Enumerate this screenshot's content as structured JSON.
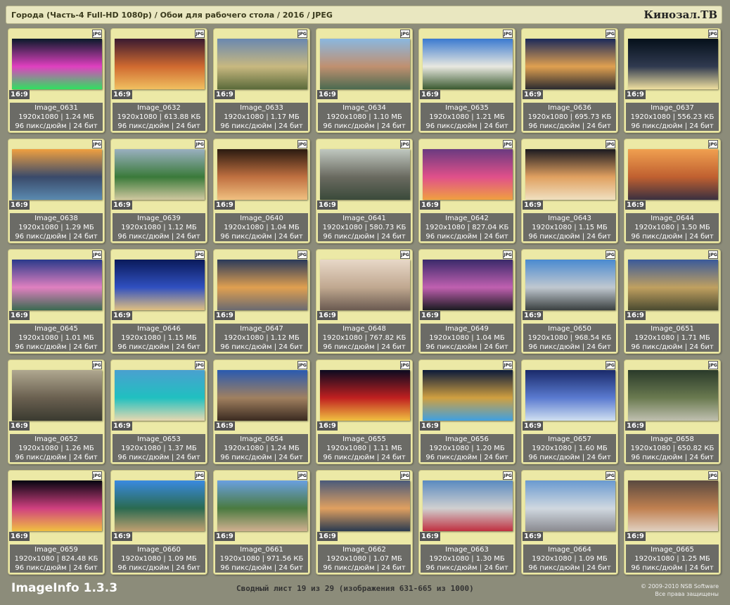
{
  "header": {
    "title": "Города (Часть-4 Full-HD 1080p) / Обои для рабочего стола / 2016 / JPEG",
    "brand": "Кинозал.ТВ"
  },
  "badge_label": "16:9",
  "file_icon_label": "JPG",
  "images": [
    {
      "name": "Image_0631",
      "dims": "1920x1080 | 1.24 МБ",
      "meta": "96 пикс/дюйм | 24 бит",
      "colors": [
        "#0a1a2a",
        "#e040c0",
        "#30e060"
      ]
    },
    {
      "name": "Image_0632",
      "dims": "1920x1080 | 613.88 КБ",
      "meta": "96 пикс/дюйм | 24 бит",
      "colors": [
        "#3a1a30",
        "#d06a30",
        "#f0c060"
      ]
    },
    {
      "name": "Image_0633",
      "dims": "1920x1080 | 1.17 МБ",
      "meta": "96 пикс/дюйм | 24 бит",
      "colors": [
        "#6a88b0",
        "#c8b880",
        "#5a6a3a"
      ]
    },
    {
      "name": "Image_0634",
      "dims": "1920x1080 | 1.10 МБ",
      "meta": "96 пикс/дюйм | 24 бит",
      "colors": [
        "#8ab8e0",
        "#c09070",
        "#4a6a50"
      ]
    },
    {
      "name": "Image_0635",
      "dims": "1920x1080 | 1.21 МБ",
      "meta": "96 пикс/дюйм | 24 бит",
      "colors": [
        "#3a7ad0",
        "#e8e8e0",
        "#3a5a30"
      ]
    },
    {
      "name": "Image_0636",
      "dims": "1920x1080 | 695.73 КБ",
      "meta": "96 пикс/дюйм | 24 бит",
      "colors": [
        "#1a2a5a",
        "#e0a050",
        "#2a2a30"
      ]
    },
    {
      "name": "Image_0637",
      "dims": "1920x1080 | 556.23 КБ",
      "meta": "96 пикс/дюйм | 24 бит",
      "colors": [
        "#05101a",
        "#303a50",
        "#f0e0a0"
      ]
    },
    {
      "name": "Image_0638",
      "dims": "1920x1080 | 1.29 МБ",
      "meta": "96 пикс/дюйм | 24 бит",
      "colors": [
        "#f0a040",
        "#3a4a6a",
        "#5a8ab0"
      ]
    },
    {
      "name": "Image_0639",
      "dims": "1920x1080 | 1.12 МБ",
      "meta": "96 пикс/дюйм | 24 бит",
      "colors": [
        "#9ab0c0",
        "#3a7a3a",
        "#d0c8a0"
      ]
    },
    {
      "name": "Image_0640",
      "dims": "1920x1080 | 1.04 МБ",
      "meta": "96 пикс/дюйм | 24 бит",
      "colors": [
        "#2a1a10",
        "#c07040",
        "#f0c080"
      ]
    },
    {
      "name": "Image_0641",
      "dims": "1920x1080 | 580.73 КБ",
      "meta": "96 пикс/дюйм | 24 бит",
      "colors": [
        "#c0c8c0",
        "#6a6a60",
        "#3a4a3a"
      ]
    },
    {
      "name": "Image_0642",
      "dims": "1920x1080 | 827.04 КБ",
      "meta": "96 пикс/дюйм | 24 бит",
      "colors": [
        "#6a3a80",
        "#e0508a",
        "#f0a040"
      ]
    },
    {
      "name": "Image_0643",
      "dims": "1920x1080 | 1.15 МБ",
      "meta": "96 пикс/дюйм | 24 бит",
      "colors": [
        "#1a1a20",
        "#e0a060",
        "#f0e0c0"
      ]
    },
    {
      "name": "Image_0644",
      "dims": "1920x1080 | 1.50 МБ",
      "meta": "96 пикс/дюйм | 24 бит",
      "colors": [
        "#f0a050",
        "#c06030",
        "#3a3040"
      ]
    },
    {
      "name": "Image_0645",
      "dims": "1920x1080 | 1.01 МБ",
      "meta": "96 пикс/дюйм | 24 бит",
      "colors": [
        "#2a3a8a",
        "#e080c0",
        "#3a6a50"
      ]
    },
    {
      "name": "Image_0646",
      "dims": "1920x1080 | 1.15 МБ",
      "meta": "96 пикс/дюйм | 24 бит",
      "colors": [
        "#0a1a5a",
        "#3050c0",
        "#e0c080"
      ]
    },
    {
      "name": "Image_0647",
      "dims": "1920x1080 | 1.12 МБ",
      "meta": "96 пикс/дюйм | 24 бит",
      "colors": [
        "#2a3a5a",
        "#e0a050",
        "#6a6a70"
      ]
    },
    {
      "name": "Image_0648",
      "dims": "1920x1080 | 767.82 КБ",
      "meta": "96 пикс/дюйм | 24 бит",
      "colors": [
        "#e8d8c8",
        "#c0a890",
        "#6a5a50"
      ]
    },
    {
      "name": "Image_0649",
      "dims": "1920x1080 | 1.04 МБ",
      "meta": "96 пикс/дюйм | 24 бит",
      "colors": [
        "#3a2a6a",
        "#c060b0",
        "#1a1a20"
      ]
    },
    {
      "name": "Image_0650",
      "dims": "1920x1080 | 968.54 КБ",
      "meta": "96 пикс/дюйм | 24 бит",
      "colors": [
        "#4a8ad0",
        "#c0c8d0",
        "#3a4040"
      ]
    },
    {
      "name": "Image_0651",
      "dims": "1920x1080 | 1.71 МБ",
      "meta": "96 пикс/дюйм | 24 бит",
      "colors": [
        "#3a5a9a",
        "#c0a060",
        "#4a4a30"
      ]
    },
    {
      "name": "Image_0652",
      "dims": "1920x1080 | 1.26 МБ",
      "meta": "96 пикс/дюйм | 24 бит",
      "colors": [
        "#b0a890",
        "#6a6050",
        "#3a3a30"
      ]
    },
    {
      "name": "Image_0653",
      "dims": "1920x1080 | 1.37 МБ",
      "meta": "96 пикс/дюйм | 24 бит",
      "colors": [
        "#4aa0d0",
        "#20c0c0",
        "#e8d8b0"
      ]
    },
    {
      "name": "Image_0654",
      "dims": "1920x1080 | 1.24 МБ",
      "meta": "96 пикс/дюйм | 24 бит",
      "colors": [
        "#2a5ab0",
        "#a08060",
        "#3a2a20"
      ]
    },
    {
      "name": "Image_0655",
      "dims": "1920x1080 | 1.11 МБ",
      "meta": "96 пикс/дюйм | 24 бит",
      "colors": [
        "#0a0a20",
        "#c02020",
        "#f0c040"
      ]
    },
    {
      "name": "Image_0656",
      "dims": "1920x1080 | 1.20 МБ",
      "meta": "96 пикс/дюйм | 24 бит",
      "colors": [
        "#0a1a3a",
        "#d0a040",
        "#40a0e0"
      ]
    },
    {
      "name": "Image_0657",
      "dims": "1920x1080 | 1.60 МБ",
      "meta": "96 пикс/дюйм | 24 бит",
      "colors": [
        "#1a2a6a",
        "#5a7ad0",
        "#d0e0f0"
      ]
    },
    {
      "name": "Image_0658",
      "dims": "1920x1080 | 650.82 КБ",
      "meta": "96 пикс/дюйм | 24 бит",
      "colors": [
        "#2a3a2a",
        "#6a7a50",
        "#c0c0b0"
      ]
    },
    {
      "name": "Image_0659",
      "dims": "1920x1080 | 824.48 КБ",
      "meta": "96 пикс/дюйм | 24 бит",
      "colors": [
        "#050510",
        "#d04080",
        "#f0c040"
      ]
    },
    {
      "name": "Image_0660",
      "dims": "1920x1080 | 1.09 МБ",
      "meta": "96 пикс/дюйм | 24 бит",
      "colors": [
        "#3a8ae0",
        "#2a6a50",
        "#c0a070"
      ]
    },
    {
      "name": "Image_0661",
      "dims": "1920x1080 | 971.56 КБ",
      "meta": "96 пикс/дюйм | 24 бит",
      "colors": [
        "#6aa0e0",
        "#4a7a40",
        "#d0b090"
      ]
    },
    {
      "name": "Image_0662",
      "dims": "1920x1080 | 1.07 МБ",
      "meta": "96 пикс/дюйм | 24 бит",
      "colors": [
        "#4a5a7a",
        "#e0a060",
        "#2a3a50"
      ]
    },
    {
      "name": "Image_0663",
      "dims": "1920x1080 | 1.30 МБ",
      "meta": "96 пикс/дюйм | 24 бит",
      "colors": [
        "#5a8ac0",
        "#d0d0d0",
        "#c03040"
      ]
    },
    {
      "name": "Image_0664",
      "dims": "1920x1080 | 1.09 МБ",
      "meta": "96 пикс/дюйм | 24 бит",
      "colors": [
        "#6a9ad0",
        "#d0d8e0",
        "#8a8a90"
      ]
    },
    {
      "name": "Image_0665",
      "dims": "1920x1080 | 1.25 МБ",
      "meta": "96 пикс/дюйм | 24 бит",
      "colors": [
        "#5a4a40",
        "#c08050",
        "#e0d0c0"
      ]
    }
  ],
  "footer": {
    "app_name": "ImageInfo 1.3.3",
    "sheet_info": "Сводный лист 19 из 29 (изображения 631-665 из 1000)",
    "copyright": "© 2009-2010 NSB Software",
    "rights": "Все права защищены"
  }
}
